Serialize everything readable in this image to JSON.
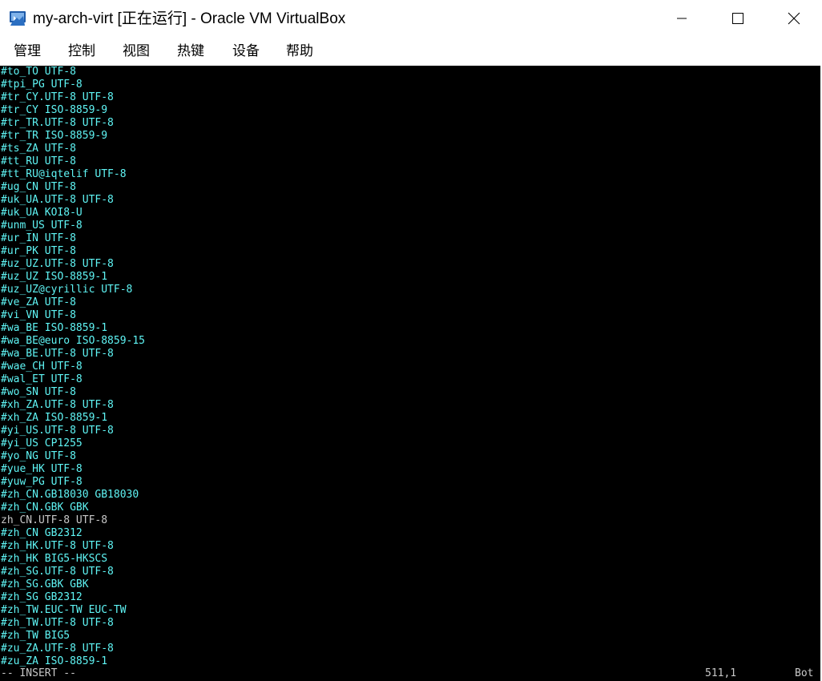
{
  "window": {
    "title": "my-arch-virt [正在运行] - Oracle VM VirtualBox"
  },
  "menu": [
    {
      "label": "管理"
    },
    {
      "label": "控制"
    },
    {
      "label": "视图"
    },
    {
      "label": "热键"
    },
    {
      "label": "设备"
    },
    {
      "label": "帮助"
    }
  ],
  "terminal": {
    "lines": [
      {
        "text": "#to_TO UTF-8",
        "commented": true
      },
      {
        "text": "#tpi_PG UTF-8",
        "commented": true
      },
      {
        "text": "#tr_CY.UTF-8 UTF-8",
        "commented": true
      },
      {
        "text": "#tr_CY ISO-8859-9",
        "commented": true
      },
      {
        "text": "#tr_TR.UTF-8 UTF-8",
        "commented": true
      },
      {
        "text": "#tr_TR ISO-8859-9",
        "commented": true
      },
      {
        "text": "#ts_ZA UTF-8",
        "commented": true
      },
      {
        "text": "#tt_RU UTF-8",
        "commented": true
      },
      {
        "text": "#tt_RU@iqtelif UTF-8",
        "commented": true
      },
      {
        "text": "#ug_CN UTF-8",
        "commented": true
      },
      {
        "text": "#uk_UA.UTF-8 UTF-8",
        "commented": true
      },
      {
        "text": "#uk_UA KOI8-U",
        "commented": true
      },
      {
        "text": "#unm_US UTF-8",
        "commented": true
      },
      {
        "text": "#ur_IN UTF-8",
        "commented": true
      },
      {
        "text": "#ur_PK UTF-8",
        "commented": true
      },
      {
        "text": "#uz_UZ.UTF-8 UTF-8",
        "commented": true
      },
      {
        "text": "#uz_UZ ISO-8859-1",
        "commented": true
      },
      {
        "text": "#uz_UZ@cyrillic UTF-8",
        "commented": true
      },
      {
        "text": "#ve_ZA UTF-8",
        "commented": true
      },
      {
        "text": "#vi_VN UTF-8",
        "commented": true
      },
      {
        "text": "#wa_BE ISO-8859-1",
        "commented": true
      },
      {
        "text": "#wa_BE@euro ISO-8859-15",
        "commented": true
      },
      {
        "text": "#wa_BE.UTF-8 UTF-8",
        "commented": true
      },
      {
        "text": "#wae_CH UTF-8",
        "commented": true
      },
      {
        "text": "#wal_ET UTF-8",
        "commented": true
      },
      {
        "text": "#wo_SN UTF-8",
        "commented": true
      },
      {
        "text": "#xh_ZA.UTF-8 UTF-8",
        "commented": true
      },
      {
        "text": "#xh_ZA ISO-8859-1",
        "commented": true
      },
      {
        "text": "#yi_US.UTF-8 UTF-8",
        "commented": true
      },
      {
        "text": "#yi_US CP1255",
        "commented": true
      },
      {
        "text": "#yo_NG UTF-8",
        "commented": true
      },
      {
        "text": "#yue_HK UTF-8",
        "commented": true
      },
      {
        "text": "#yuw_PG UTF-8",
        "commented": true
      },
      {
        "text": "#zh_CN.GB18030 GB18030",
        "commented": true
      },
      {
        "text": "#zh_CN.GBK GBK",
        "commented": true
      },
      {
        "text": "zh_CN.UTF-8 UTF-8",
        "commented": false
      },
      {
        "text": "#zh_CN GB2312",
        "commented": true
      },
      {
        "text": "#zh_HK.UTF-8 UTF-8",
        "commented": true
      },
      {
        "text": "#zh_HK BIG5-HKSCS",
        "commented": true
      },
      {
        "text": "#zh_SG.UTF-8 UTF-8",
        "commented": true
      },
      {
        "text": "#zh_SG.GBK GBK",
        "commented": true
      },
      {
        "text": "#zh_SG GB2312",
        "commented": true
      },
      {
        "text": "#zh_TW.EUC-TW EUC-TW",
        "commented": true
      },
      {
        "text": "#zh_TW.UTF-8 UTF-8",
        "commented": true
      },
      {
        "text": "#zh_TW BIG5",
        "commented": true
      },
      {
        "text": "#zu_ZA.UTF-8 UTF-8",
        "commented": true
      },
      {
        "text": "#zu_ZA ISO-8859-1",
        "commented": true
      }
    ],
    "status": {
      "mode": "-- INSERT --",
      "position": "511,1",
      "scroll": "Bot"
    }
  },
  "colors": {
    "comment_text": "#5ff5f5",
    "plain_text": "#c8c8c8",
    "background": "#000000"
  },
  "icons": {
    "app": "virtualbox-icon",
    "minimize": "minimize-icon",
    "maximize": "maximize-icon",
    "close": "close-icon"
  }
}
